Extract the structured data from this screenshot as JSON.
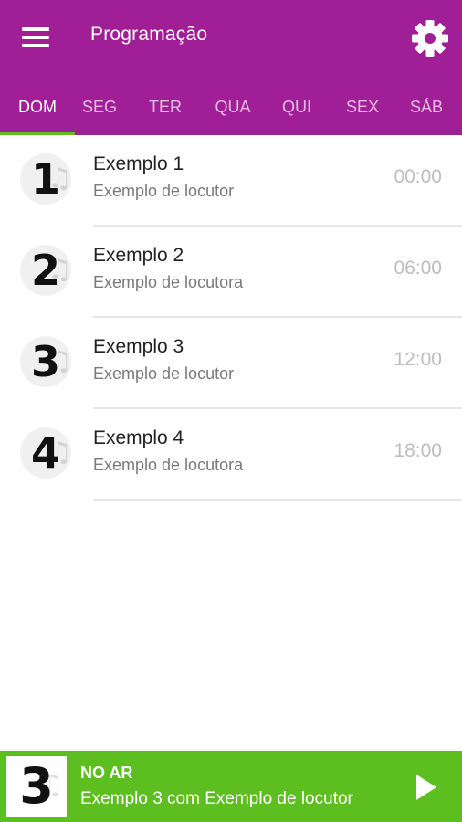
{
  "header": {
    "title": "Programação",
    "menu_icon": "hamburger-menu-icon",
    "settings_icon": "gear-icon",
    "background_color": "#a01f97"
  },
  "tabs": [
    {
      "label": "DOM",
      "active": true
    },
    {
      "label": "SEG",
      "active": false
    },
    {
      "label": "TER",
      "active": false
    },
    {
      "label": "QUA",
      "active": false
    },
    {
      "label": "QUI",
      "active": false
    },
    {
      "label": "SEX",
      "active": false
    },
    {
      "label": "SÁB",
      "active": false
    }
  ],
  "tab_indicator_color": "#60bf1f",
  "schedule": [
    {
      "number": "1",
      "title": "Exemplo 1",
      "host": "Exemplo de locutor",
      "time": "00:00"
    },
    {
      "number": "2",
      "title": "Exemplo 2",
      "host": "Exemplo de locutora",
      "time": "06:00"
    },
    {
      "number": "3",
      "title": "Exemplo 3",
      "host": "Exemplo de locutor",
      "time": "12:00"
    },
    {
      "number": "4",
      "title": "Exemplo 4",
      "host": "Exemplo de locutora",
      "time": "18:00"
    }
  ],
  "now_playing": {
    "label": "NO AR",
    "number": "3",
    "detail": "Exemplo 3 com Exemplo de locutor",
    "play_icon": "play-icon",
    "background_color": "#5dbf1f"
  }
}
